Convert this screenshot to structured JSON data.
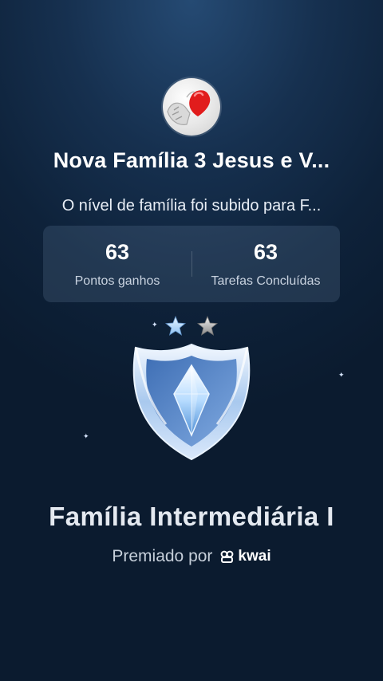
{
  "group": {
    "name": "Nova Família 3 Jesus e V...",
    "avatar_icon": "heart-in-hands-icon"
  },
  "level_message": "O nível de família foi subido para F...",
  "stats": [
    {
      "value": "63",
      "label": "Pontos ganhos"
    },
    {
      "value": "63",
      "label": "Tarefas Concluídas"
    }
  ],
  "badge": {
    "stars_filled": 1,
    "stars_total": 2,
    "icon": "shield-crystal-badge-icon",
    "level_title": "Família Intermediária I"
  },
  "awarded": {
    "prefix": "Premiado por",
    "brand": "kwai",
    "brand_icon": "kwai-logo-icon"
  },
  "colors": {
    "background_top": "#254a73",
    "background_bottom": "#0b1b2f",
    "star_filled": "#bfe0ff",
    "star_empty": "#c7c7c7",
    "badge_blue": "#8fbbea"
  }
}
